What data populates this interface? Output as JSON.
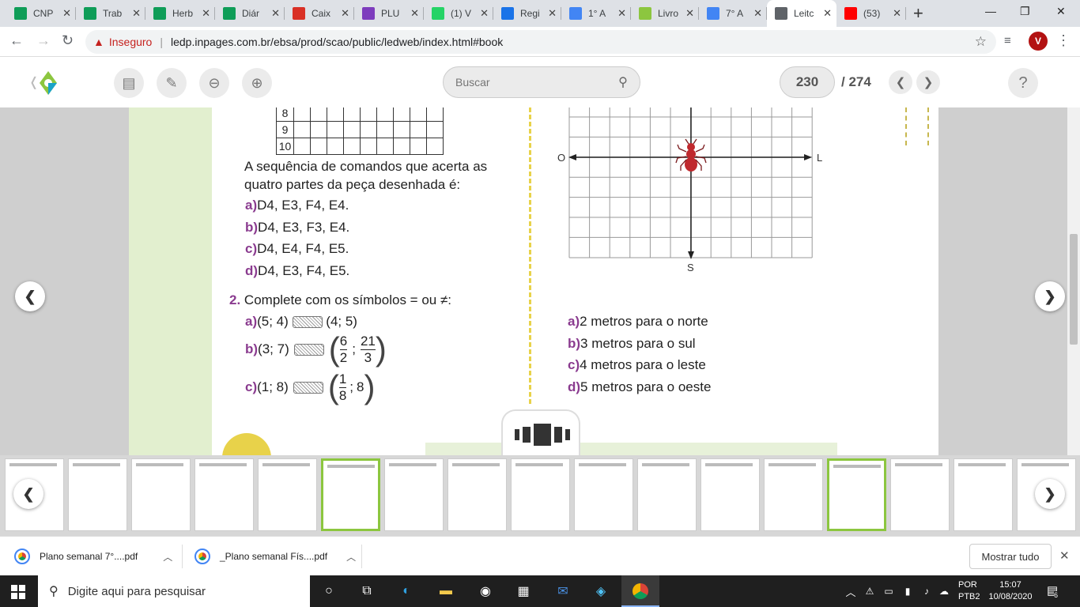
{
  "browser": {
    "tabs": [
      {
        "title": "CNP",
        "icon": "sheets-icon",
        "color": "#0f9d58"
      },
      {
        "title": "Trab",
        "icon": "sheets-icon",
        "color": "#0f9d58"
      },
      {
        "title": "Herb",
        "icon": "sheets-icon",
        "color": "#0f9d58"
      },
      {
        "title": "Diár",
        "icon": "sheets-icon",
        "color": "#0f9d58"
      },
      {
        "title": "Caix",
        "icon": "gmail-icon",
        "color": "#d93025"
      },
      {
        "title": "PLU",
        "icon": "plural-icon",
        "color": "#7d3cbd"
      },
      {
        "title": "(1) V",
        "icon": "whatsapp-icon",
        "color": "#25d366"
      },
      {
        "title": "Regi",
        "icon": "edge-icon",
        "color": "#1a73e8"
      },
      {
        "title": "1° A",
        "icon": "docs-icon",
        "color": "#4285f4"
      },
      {
        "title": "Livro",
        "icon": "ledp-icon",
        "color": "#8cc63f"
      },
      {
        "title": "7° A",
        "icon": "docs-icon",
        "color": "#4285f4"
      },
      {
        "title": "Leitc",
        "icon": "globe-icon",
        "color": "#5f6368"
      },
      {
        "title": "(53)",
        "icon": "youtube-icon",
        "color": "#ff0000"
      }
    ],
    "new_tab": "+",
    "address": {
      "security": "Inseguro",
      "url": "ledp.inpages.com.br/ebsa/prod/scao/public/ledweb/index.html#book"
    },
    "avatar_letter": "V"
  },
  "reader": {
    "search_placeholder": "Buscar",
    "current_page": "230",
    "total_pages": "/ 274",
    "help": "?"
  },
  "book": {
    "grid_rows": [
      "8",
      "9",
      "10"
    ],
    "q1_text": "A sequência de comandos que acerta as quatro partes da peça desenhada é:",
    "q1_options": [
      {
        "letter": "a)",
        "text": "D4, E3, F4, E4."
      },
      {
        "letter": "b)",
        "text": "D4, E3, F3, E4."
      },
      {
        "letter": "c)",
        "text": "D4, E4, F4, E5."
      },
      {
        "letter": "d)",
        "text": "D4, E3, F4, E5."
      }
    ],
    "q2_number": "2.",
    "q2_text": "Complete com os símbolos = ou ≠:",
    "q2_items": {
      "a": {
        "letter": "a)",
        "left": "(5; 4)",
        "right": "(4; 5)"
      },
      "b": {
        "letter": "b)",
        "left": "(3; 7)",
        "f1_num": "6",
        "f1_den": "2",
        "f2_num": "21",
        "f2_den": "3"
      },
      "c": {
        "letter": "c)",
        "left": "(1; 8)",
        "f_num": "1",
        "f_den": "8",
        "after": "8"
      }
    },
    "compass": {
      "west": "O",
      "east": "L",
      "south": "S"
    },
    "right_options": [
      {
        "letter": "a)",
        "text": "2 metros para o norte"
      },
      {
        "letter": "b)",
        "text": "3 metros para o sul"
      },
      {
        "letter": "c)",
        "text": "4 metros para o leste"
      },
      {
        "letter": "d)",
        "text": "5 metros para o oeste"
      }
    ]
  },
  "downloads": {
    "items": [
      {
        "name": "Plano semanal 7°....pdf"
      },
      {
        "name": "_Plano semanal Fís....pdf"
      }
    ],
    "show_all": "Mostrar tudo"
  },
  "taskbar": {
    "search_placeholder": "Digite aqui para pesquisar",
    "lang": "POR",
    "layout": "PTB2",
    "time": "15:07",
    "date": "10/08/2020",
    "notif_count": "6"
  }
}
